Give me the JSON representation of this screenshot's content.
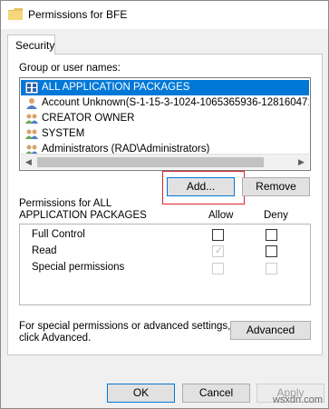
{
  "window": {
    "title": "Permissions for BFE"
  },
  "tabs": [
    {
      "label": "Security"
    }
  ],
  "groups": {
    "label": "Group or user names:",
    "items": [
      {
        "label": "ALL APPLICATION PACKAGES",
        "icon": "packages-icon",
        "selected": true
      },
      {
        "label": "Account Unknown(S-1-15-3-1024-1065365936-128160471",
        "icon": "user-icon"
      },
      {
        "label": "CREATOR OWNER",
        "icon": "users-icon"
      },
      {
        "label": "SYSTEM",
        "icon": "users-icon"
      },
      {
        "label": "Administrators (RAD\\Administrators)",
        "icon": "users-icon"
      }
    ]
  },
  "buttons": {
    "add": "Add...",
    "remove": "Remove",
    "advanced": "Advanced",
    "ok": "OK",
    "cancel": "Cancel",
    "apply": "Apply"
  },
  "permissions": {
    "label_line1": "Permissions for ALL",
    "label_line2": "APPLICATION PACKAGES",
    "col_allow": "Allow",
    "col_deny": "Deny",
    "rows": [
      {
        "label": "Full Control",
        "allow": false,
        "deny": false,
        "disabled": false
      },
      {
        "label": "Read",
        "allow": true,
        "deny": false,
        "disabled": false
      },
      {
        "label": "Special permissions",
        "allow": false,
        "deny": false,
        "disabled": true
      }
    ]
  },
  "advanced_note": {
    "line1": "For special permissions or advanced settings,",
    "line2": "click Advanced."
  },
  "watermark": "wsxdn.com",
  "colors": {
    "selection": "#0078d7",
    "highlight": "#d9232e"
  }
}
